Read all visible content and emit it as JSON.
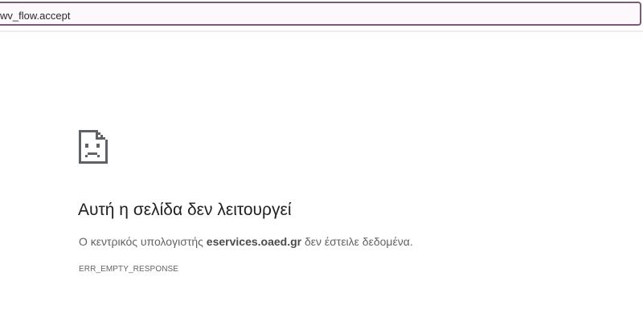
{
  "address_bar": {
    "value": "wv_flow.accept"
  },
  "error_page": {
    "icon": "sad-document-icon",
    "title": "Αυτή η σελίδα δεν λειτουργεί",
    "message_prefix": "Ο κεντρικός υπολογιστής ",
    "host": "eservices.oaed.gr",
    "message_suffix": " δεν έστειλε δεδομένα.",
    "error_code": "ERR_EMPTY_RESPONSE"
  },
  "colors": {
    "address_border": "#7a5a76",
    "title": "#202124",
    "text": "#5f6368",
    "icon": "#5f6368"
  }
}
